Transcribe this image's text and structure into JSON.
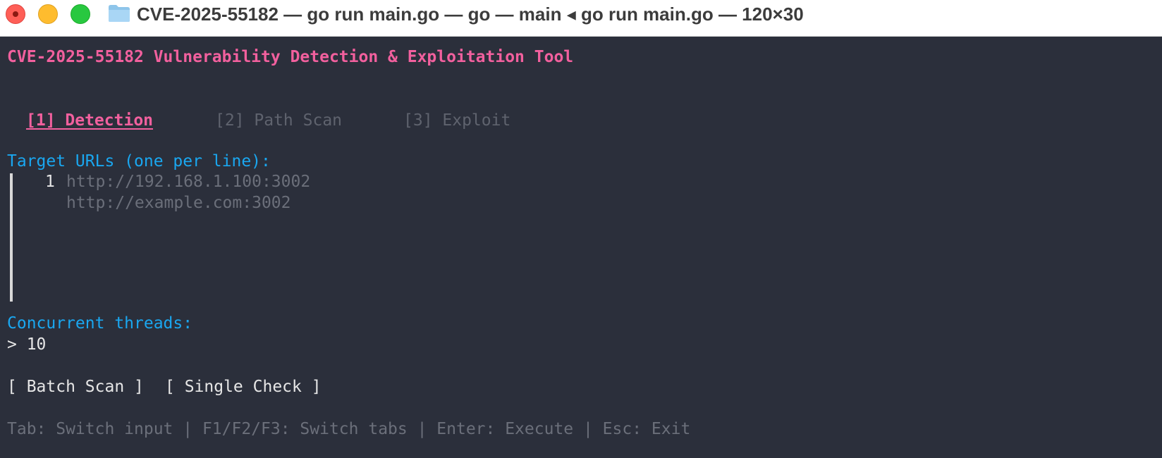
{
  "window": {
    "title": "CVE-2025-55182 — go run main.go — go — main ◂ go run main.go — 120×30"
  },
  "app": {
    "title": "CVE-2025-55182 Vulnerability Detection & Exploitation Tool"
  },
  "tabs": [
    {
      "label": "[1] Detection",
      "active": true
    },
    {
      "label": "[2] Path Scan",
      "active": false
    },
    {
      "label": "[3] Exploit",
      "active": false
    }
  ],
  "detection": {
    "urls_label": "Target URLs (one per line):",
    "line_number": "1",
    "placeholder_lines": [
      "http://192.168.1.100:3002",
      "http://example.com:3002"
    ],
    "threads_label": "Concurrent threads:",
    "threads_prompt": "> 10",
    "batch_button": "[ Batch Scan ]",
    "single_button": "[ Single Check ]"
  },
  "help": {
    "text": "Tab: Switch input | F1/F2/F3: Switch tabs | Enter: Execute | Esc: Exit"
  },
  "colors": {
    "accent_pink": "#f2609e",
    "label_blue": "#1aa7f0",
    "background": "#2b2f3b",
    "dim_text": "#6b6f7a"
  },
  "icons": {
    "folder": "folder-icon",
    "close": "close-icon",
    "minimize": "minimize-icon",
    "maximize": "maximize-icon"
  }
}
